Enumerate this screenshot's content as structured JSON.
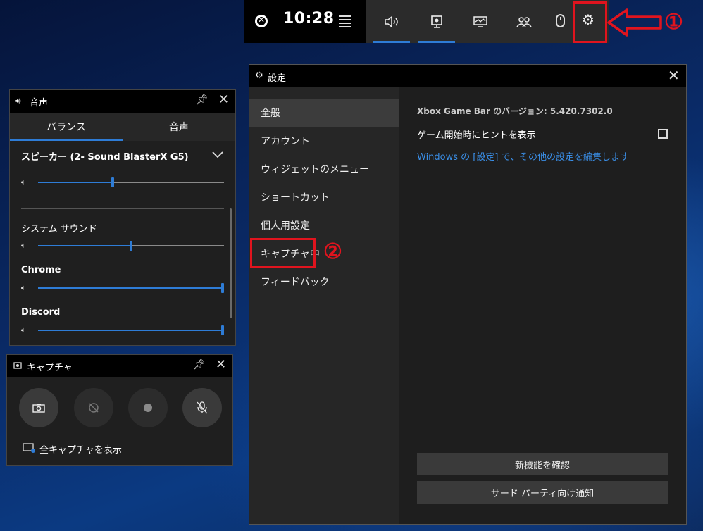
{
  "topbar": {
    "time": "10:28",
    "icons": [
      "xbox-icon",
      "menu-icon",
      "audio-icon",
      "capture-icon",
      "performance-icon",
      "social-icon",
      "mouse-icon",
      "settings-gear-icon"
    ]
  },
  "annotations": {
    "marker1": "①",
    "marker2": "②"
  },
  "sound_widget": {
    "title": "音声",
    "tabs": [
      "バランス",
      "音声"
    ],
    "active_tab": 0,
    "device_name": "スピーカー (2- Sound BlasterX G5)",
    "device_volume": 0.41,
    "apps": [
      {
        "name": "システム サウンド",
        "volume": 0.5
      },
      {
        "name": "Chrome",
        "volume": 1.0
      },
      {
        "name": "Discord",
        "volume": 1.0
      }
    ]
  },
  "capture_widget": {
    "title": "キャプチャ",
    "show_all_label": "全キャプチャを表示",
    "buttons": [
      "screenshot",
      "record-last-30s",
      "record",
      "mic-mute"
    ]
  },
  "settings": {
    "title": "設定",
    "nav": [
      "全般",
      "アカウント",
      "ウィジェットのメニュー",
      "ショートカット",
      "個人用設定",
      "キャプチャ中",
      "フィードバック"
    ],
    "active_nav": 0,
    "version_text": "Xbox Game Bar のバージョン: 5.420.7302.0",
    "hint_label": "ゲーム開始時にヒントを表示",
    "hint_checked": false,
    "link_text": "Windows の [設定] で、その他の設定を編集します",
    "btn_whats_new": "新機能を確認",
    "btn_third_party": "サード パーティ向け通知"
  },
  "colors": {
    "accent": "#2e7cd6",
    "annotation_red": "#e0141e"
  }
}
